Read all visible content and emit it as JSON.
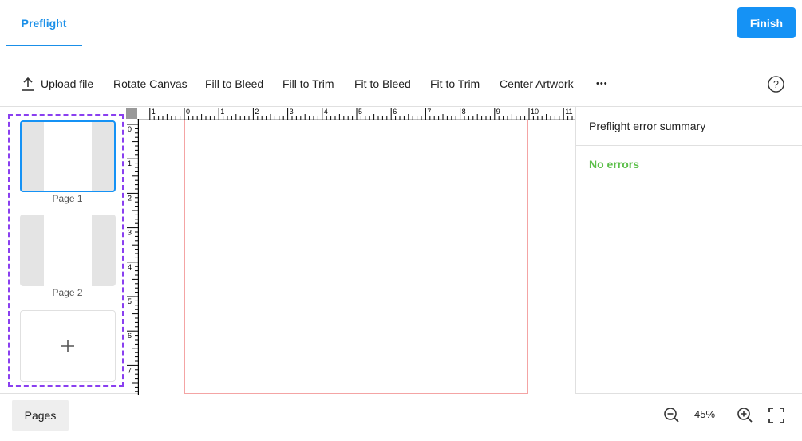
{
  "header": {
    "tab_label": "Preflight",
    "finish_label": "Finish"
  },
  "toolbar": {
    "upload_label": "Upload file",
    "rotate_label": "Rotate Canvas",
    "fill_bleed_label": "Fill to Bleed",
    "fill_trim_label": "Fill to Trim",
    "fit_bleed_label": "Fit to Bleed",
    "fit_trim_label": "Fit to Trim",
    "center_label": "Center Artwork",
    "more_label": "•••",
    "help_icon": "help-circle-icon"
  },
  "pages": {
    "items": [
      {
        "label": "Page 1",
        "selected": true
      },
      {
        "label": "Page 2",
        "selected": false
      }
    ],
    "add_icon": "plus-icon"
  },
  "rulers": {
    "horizontal_labels": [
      "1",
      "0",
      "1",
      "2",
      "3",
      "4",
      "5",
      "6",
      "7",
      "8",
      "9",
      "10",
      "11"
    ],
    "vertical_labels": [
      "0",
      "1",
      "2",
      "3",
      "4",
      "5",
      "6",
      "7"
    ]
  },
  "right_panel": {
    "title": "Preflight error summary",
    "status": "No errors"
  },
  "footer": {
    "pages_label": "Pages",
    "zoom_value": "45%",
    "zoom_out_icon": "zoom-out-icon",
    "zoom_in_icon": "zoom-in-icon",
    "fullscreen_icon": "fullscreen-icon"
  },
  "colors": {
    "accent": "#1592f5",
    "success": "#5cbf4a",
    "pages_border": "#8a3ff0",
    "trim_line": "#f4a4a4"
  }
}
